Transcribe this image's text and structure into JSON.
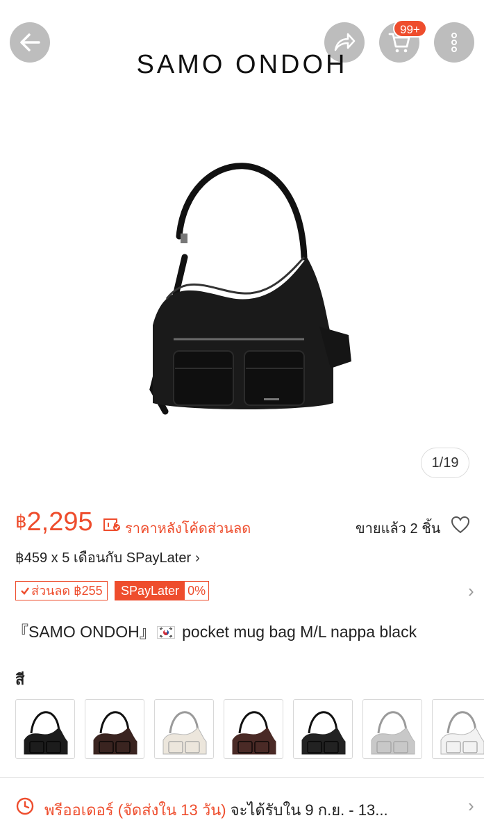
{
  "header": {
    "brand": "SAMO ONDOH",
    "cart_badge": "99+"
  },
  "gallery": {
    "counter": "1/19"
  },
  "price": {
    "currency": "฿",
    "amount": "2,295",
    "coupon_label": "ราคาหลังโค้ดส่วนลด",
    "sold": "ขายแล้ว 2 ชิ้น",
    "installment": "฿459 x 5 เดือนกับ SPayLater",
    "installment_chevron": "›"
  },
  "tags": {
    "discount": "ส่วนลด ฿255",
    "spay_name": "SPayLater",
    "spay_rate": "0%",
    "chevron": "›"
  },
  "product": {
    "title_pre": "『SAMO ONDOH』",
    "title_post": "  pocket mug bag M/L nappa black"
  },
  "variants": {
    "label": "สี",
    "items": [
      {
        "color": "#1c1c1c"
      },
      {
        "color": "#3a2420"
      },
      {
        "color": "#ece6dc"
      },
      {
        "color": "#4a2a26"
      },
      {
        "color": "#222222"
      },
      {
        "color": "#c8c8c8"
      },
      {
        "color": "#f2f2f2"
      }
    ]
  },
  "shipping": {
    "preorder": "พรีออเดอร์ (จัดส่งใน 13 วัน)",
    "receive": " จะได้รับใน 9 ก.ย. - 13...",
    "chevron": "›"
  },
  "colors": {
    "accent": "#ee4d2d"
  }
}
